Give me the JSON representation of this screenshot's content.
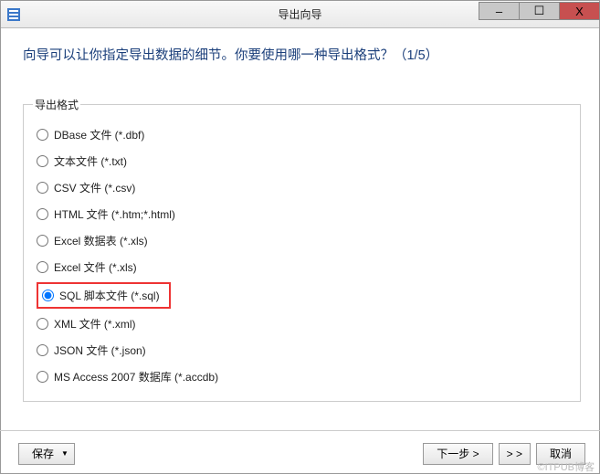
{
  "window": {
    "title": "导出向导",
    "controls": {
      "min": "–",
      "max": "☐",
      "close": "X"
    }
  },
  "heading": "向导可以让你指定导出数据的细节。你要使用哪一种导出格式？（1/5）",
  "group_legend": "导出格式",
  "options": [
    {
      "label": "DBase 文件 (*.dbf)",
      "selected": false
    },
    {
      "label": "文本文件 (*.txt)",
      "selected": false
    },
    {
      "label": "CSV 文件 (*.csv)",
      "selected": false
    },
    {
      "label": "HTML 文件 (*.htm;*.html)",
      "selected": false
    },
    {
      "label": "Excel 数据表 (*.xls)",
      "selected": false
    },
    {
      "label": "Excel 文件 (*.xls)",
      "selected": false
    },
    {
      "label": "SQL 脚本文件 (*.sql)",
      "selected": true
    },
    {
      "label": "XML 文件 (*.xml)",
      "selected": false
    },
    {
      "label": "JSON 文件 (*.json)",
      "selected": false
    },
    {
      "label": "MS Access 2007 数据库 (*.accdb)",
      "selected": false
    }
  ],
  "footer": {
    "save": "保存",
    "next": "下一步 >",
    "skip": "> >",
    "cancel": "取消"
  },
  "watermark": "©ITPUB博客"
}
